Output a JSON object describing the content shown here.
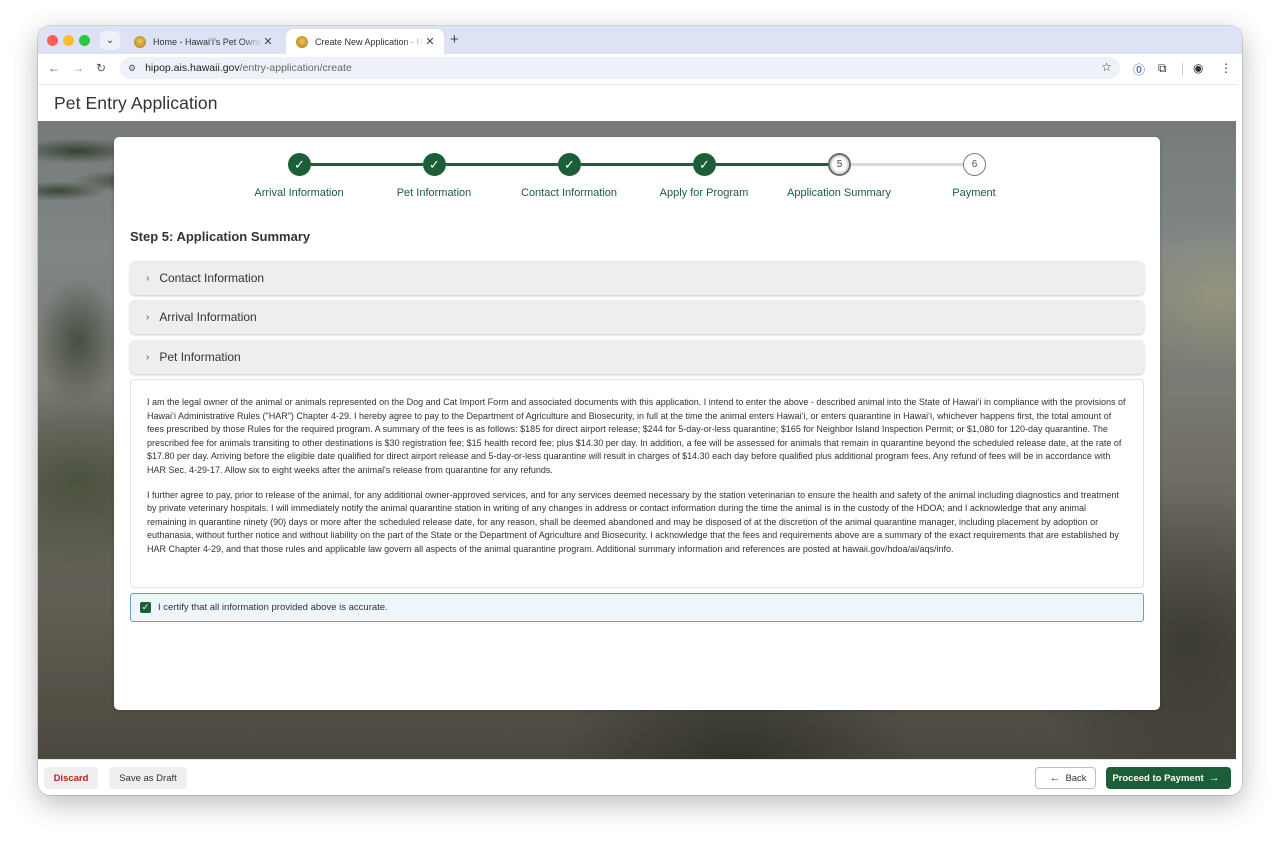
{
  "browser": {
    "tabs": [
      {
        "title": "Home - Hawaiʻi's Pet Owner Services",
        "active": false
      },
      {
        "title": "Create New Application - Hawaiʻi's Pet Owner Services",
        "active": true
      }
    ],
    "url_host": "hipop.ais.hawaii.gov",
    "url_path": "/entry-application/create"
  },
  "header": {
    "title": "Pet Entry Application"
  },
  "stepper": {
    "steps": [
      {
        "number": "1",
        "label": "Arrival Information",
        "state": "done"
      },
      {
        "number": "2",
        "label": "Pet Information",
        "state": "done"
      },
      {
        "number": "3",
        "label": "Contact Information",
        "state": "done"
      },
      {
        "number": "4",
        "label": "Apply for Program",
        "state": "done"
      },
      {
        "number": "5",
        "label": "Application Summary",
        "state": "current"
      },
      {
        "number": "6",
        "label": "Payment",
        "state": "todo"
      }
    ]
  },
  "main": {
    "section_title": "Step 5: Application Summary",
    "accordions": [
      {
        "label": "Contact Information"
      },
      {
        "label": "Arrival Information"
      },
      {
        "label": "Pet Information"
      }
    ],
    "terms": {
      "p1": "I am the legal owner of the animal or animals represented on the Dog and Cat Import Form and associated documents with this application. I intend to enter the above - described animal into the State of Hawaiʻi in compliance with the provisions of Hawaiʻi Administrative Rules (\"HAR\") Chapter 4-29. I hereby agree to pay to the Department of Agriculture and Biosecurity, in full at the time the animal enters Hawaiʻi, or enters quarantine in Hawaiʻi, whichever happens first, the total amount of fees prescribed by those Rules for the required program. A summary of the fees is as follows: $185 for direct airport release; $244 for 5-day-or-less quarantine; $165 for Neighbor Island Inspection Permit; or $1,080 for 120-day quarantine. The prescribed fee for animals transiting to other destinations is $30 registration fee; $15 health record fee; plus $14.30 per day. In addition, a fee will be assessed for animals that remain in quarantine beyond the scheduled release date, at the rate of $17.80 per day. Arriving before the eligible date qualified for direct airport release and 5-day-or-less quarantine will result in charges of $14.30 each day before qualified plus additional program fees. Any refund of fees will be in accordance with HAR Sec. 4-29-17. Allow six to eight weeks after the animal's release from quarantine for any refunds.",
      "p2": "I further agree to pay, prior to release of the animal, for any additional owner-approved services, and for any services deemed necessary by the station veterinarian to ensure the health and safety of the animal including diagnostics and treatment by private veterinary hospitals. I will immediately notify the animal quarantine station in writing of any changes in address or contact information during the time the animal is in the custody of the HDOA; and I acknowledge that any animal remaining in quarantine ninety (90) days or more after the scheduled release date, for any reason, shall be deemed abandoned and may be disposed of at the discretion of the animal quarantine manager, including placement by adoption or euthanasia, without further notice and without liability on the part of the State or the Department of Agriculture and Biosecurity. I acknowledge that the fees and requirements above are a summary of the exact requirements that are established by HAR Chapter 4-29, and that those rules and applicable law govern all aspects of the animal quarantine program. Additional summary information and references are posted at hawaii.gov/hdoa/ai/aqs/info."
    },
    "certify_label": "I certify that all information provided above is accurate.",
    "certify_checked": true
  },
  "footer": {
    "discard_label": "Discard",
    "draft_label": "Save as Draft",
    "back_label": "Back",
    "proceed_label": "Proceed to Payment"
  },
  "colors": {
    "brand_green": "#1b5e38",
    "danger_red": "#b3261e",
    "focus_blue": "#6b9bd0"
  }
}
